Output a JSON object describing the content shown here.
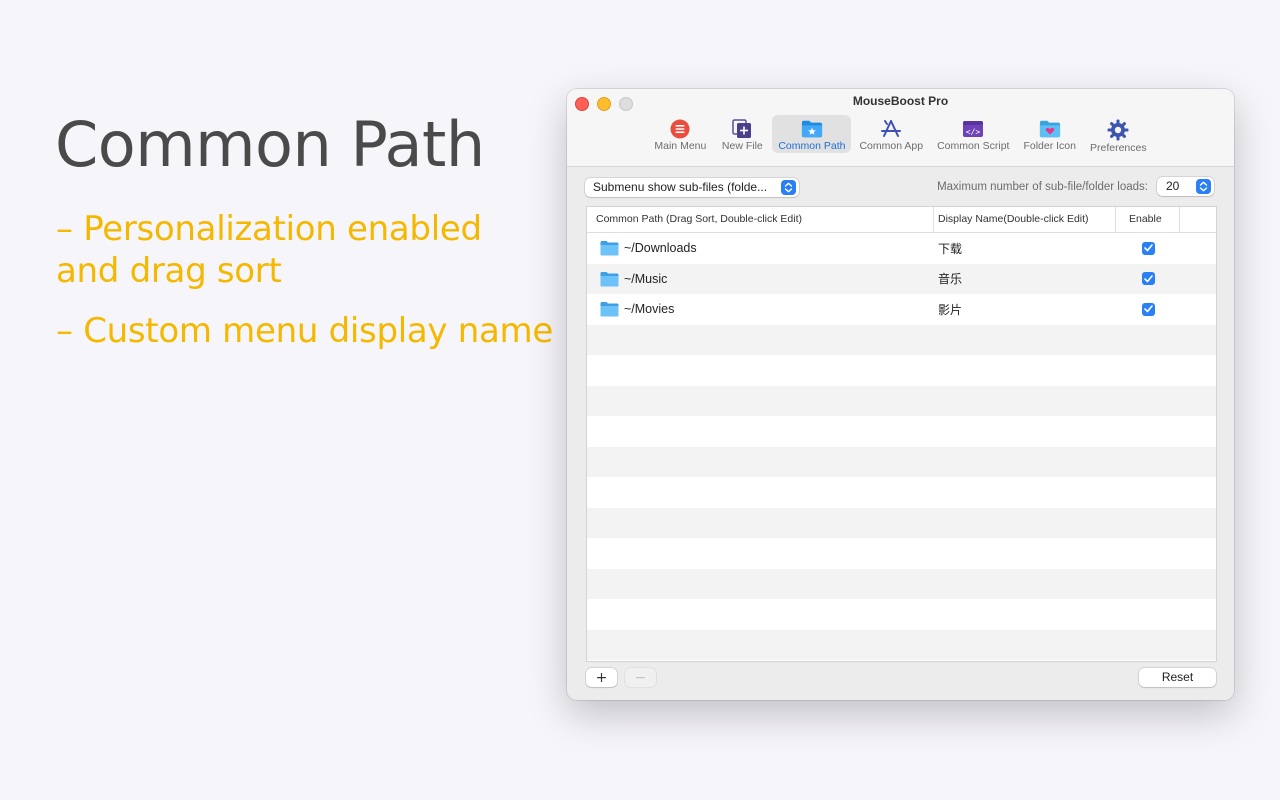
{
  "promo": {
    "title": "Common Path",
    "bullet1": "– Personalization enabled and drag sort",
    "bullet2": "– Custom menu display name",
    "accent_color": "#f5b800"
  },
  "window": {
    "title": "MouseBoost Pro",
    "toolbar": [
      {
        "label": "Main Menu",
        "icon": "main-menu-icon",
        "active": false
      },
      {
        "label": "New File",
        "icon": "new-file-icon",
        "active": false
      },
      {
        "label": "Common Path",
        "icon": "common-path-folder-icon",
        "active": true
      },
      {
        "label": "Common App",
        "icon": "app-store-icon",
        "active": false
      },
      {
        "label": "Common Script",
        "icon": "script-icon",
        "active": false
      },
      {
        "label": "Folder Icon",
        "icon": "folder-heart-icon",
        "active": false
      },
      {
        "label": "Preferences",
        "icon": "gear-icon",
        "active": false
      }
    ]
  },
  "controls": {
    "submenu_popup": "Submenu show sub-files (folde...",
    "max_label": "Maximum number of sub-file/folder loads:",
    "max_value": "20"
  },
  "table": {
    "headers": [
      "Common Path (Drag Sort, Double-click Edit)",
      "Display Name(Double-click Edit)",
      "Enable"
    ],
    "rows": [
      {
        "path": "~/Downloads",
        "display": "下载",
        "enabled": true
      },
      {
        "path": "~/Music",
        "display": "音乐",
        "enabled": true
      },
      {
        "path": "~/Movies",
        "display": "影片",
        "enabled": true
      }
    ]
  },
  "footer": {
    "add": "+",
    "remove": "−",
    "reset": "Reset"
  }
}
